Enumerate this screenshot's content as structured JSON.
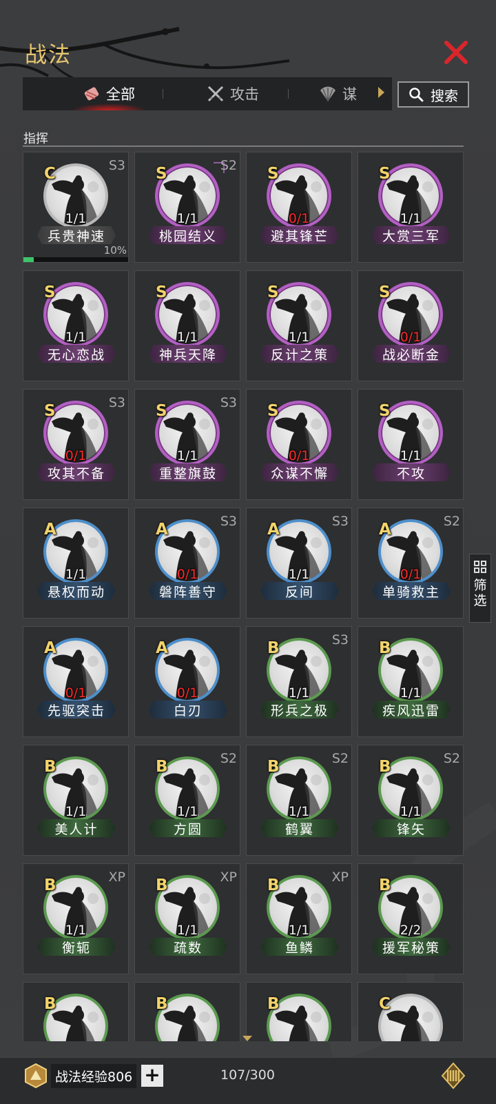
{
  "header": {
    "title": "战法"
  },
  "tabs": [
    {
      "label": "全部",
      "icon": "scroll-bundle-icon",
      "active": true
    },
    {
      "label": "攻击",
      "icon": "crossed-swords-icon",
      "active": false
    },
    {
      "label": "谋",
      "icon": "fan-icon",
      "active": false
    }
  ],
  "search": {
    "label": "搜索"
  },
  "section": {
    "title": "指挥"
  },
  "filter": {
    "label": "筛选"
  },
  "skills": [
    {
      "rank": "C",
      "tier": "S3",
      "count": "1/1",
      "name": "兵贵神速",
      "progress_percent": 10,
      "progress_label": "10%"
    },
    {
      "rank": "S",
      "tier": "S2",
      "count": "1/1",
      "name": "桃园结义"
    },
    {
      "rank": "S",
      "tier": "",
      "count": "0/1",
      "name": "避其锋芒"
    },
    {
      "rank": "S",
      "tier": "",
      "count": "1/1",
      "name": "大赏三军"
    },
    {
      "rank": "S",
      "tier": "",
      "count": "1/1",
      "name": "无心恋战"
    },
    {
      "rank": "S",
      "tier": "",
      "count": "1/1",
      "name": "神兵天降"
    },
    {
      "rank": "S",
      "tier": "",
      "count": "1/1",
      "name": "反计之策"
    },
    {
      "rank": "S",
      "tier": "",
      "count": "0/1",
      "name": "战必断金"
    },
    {
      "rank": "S",
      "tier": "S3",
      "count": "0/1",
      "name": "攻其不备"
    },
    {
      "rank": "S",
      "tier": "S3",
      "count": "1/1",
      "name": "重整旗鼓"
    },
    {
      "rank": "S",
      "tier": "",
      "count": "0/1",
      "name": "众谋不懈"
    },
    {
      "rank": "S",
      "tier": "",
      "count": "1/1",
      "name": "不攻"
    },
    {
      "rank": "A",
      "tier": "",
      "count": "1/1",
      "name": "悬权而动"
    },
    {
      "rank": "A",
      "tier": "S3",
      "count": "0/1",
      "name": "磐阵善守"
    },
    {
      "rank": "A",
      "tier": "S3",
      "count": "1/1",
      "name": "反间"
    },
    {
      "rank": "A",
      "tier": "S2",
      "count": "0/1",
      "name": "单骑救主"
    },
    {
      "rank": "A",
      "tier": "",
      "count": "0/1",
      "name": "先驱突击"
    },
    {
      "rank": "A",
      "tier": "",
      "count": "0/1",
      "name": "白刃"
    },
    {
      "rank": "B",
      "tier": "S3",
      "count": "1/1",
      "name": "形兵之极"
    },
    {
      "rank": "B",
      "tier": "",
      "count": "1/1",
      "name": "疾风迅雷"
    },
    {
      "rank": "B",
      "tier": "",
      "count": "1/1",
      "name": "美人计"
    },
    {
      "rank": "B",
      "tier": "S2",
      "count": "1/1",
      "name": "方圆"
    },
    {
      "rank": "B",
      "tier": "S2",
      "count": "1/1",
      "name": "鹤翼"
    },
    {
      "rank": "B",
      "tier": "S2",
      "count": "1/1",
      "name": "锋矢"
    },
    {
      "rank": "B",
      "tier": "XP",
      "count": "1/1",
      "name": "衡轭"
    },
    {
      "rank": "B",
      "tier": "XP",
      "count": "1/1",
      "name": "疏数"
    },
    {
      "rank": "B",
      "tier": "XP",
      "count": "1/1",
      "name": "鱼鳞"
    },
    {
      "rank": "B",
      "tier": "",
      "count": "2/2",
      "name": "援军秘策"
    },
    {
      "rank": "B",
      "tier": "",
      "count": "",
      "name": ""
    },
    {
      "rank": "B",
      "tier": "",
      "count": "",
      "name": ""
    },
    {
      "rank": "B",
      "tier": "",
      "count": "",
      "name": ""
    },
    {
      "rank": "C",
      "tier": "",
      "count": "",
      "name": ""
    }
  ],
  "footer": {
    "exp_label": "战法经验806",
    "plus": "+",
    "capacity": "107/300"
  },
  "colors": {
    "gold": "#e6c66e",
    "close": "#d9262b",
    "zero_count": "#ff2a2a"
  }
}
